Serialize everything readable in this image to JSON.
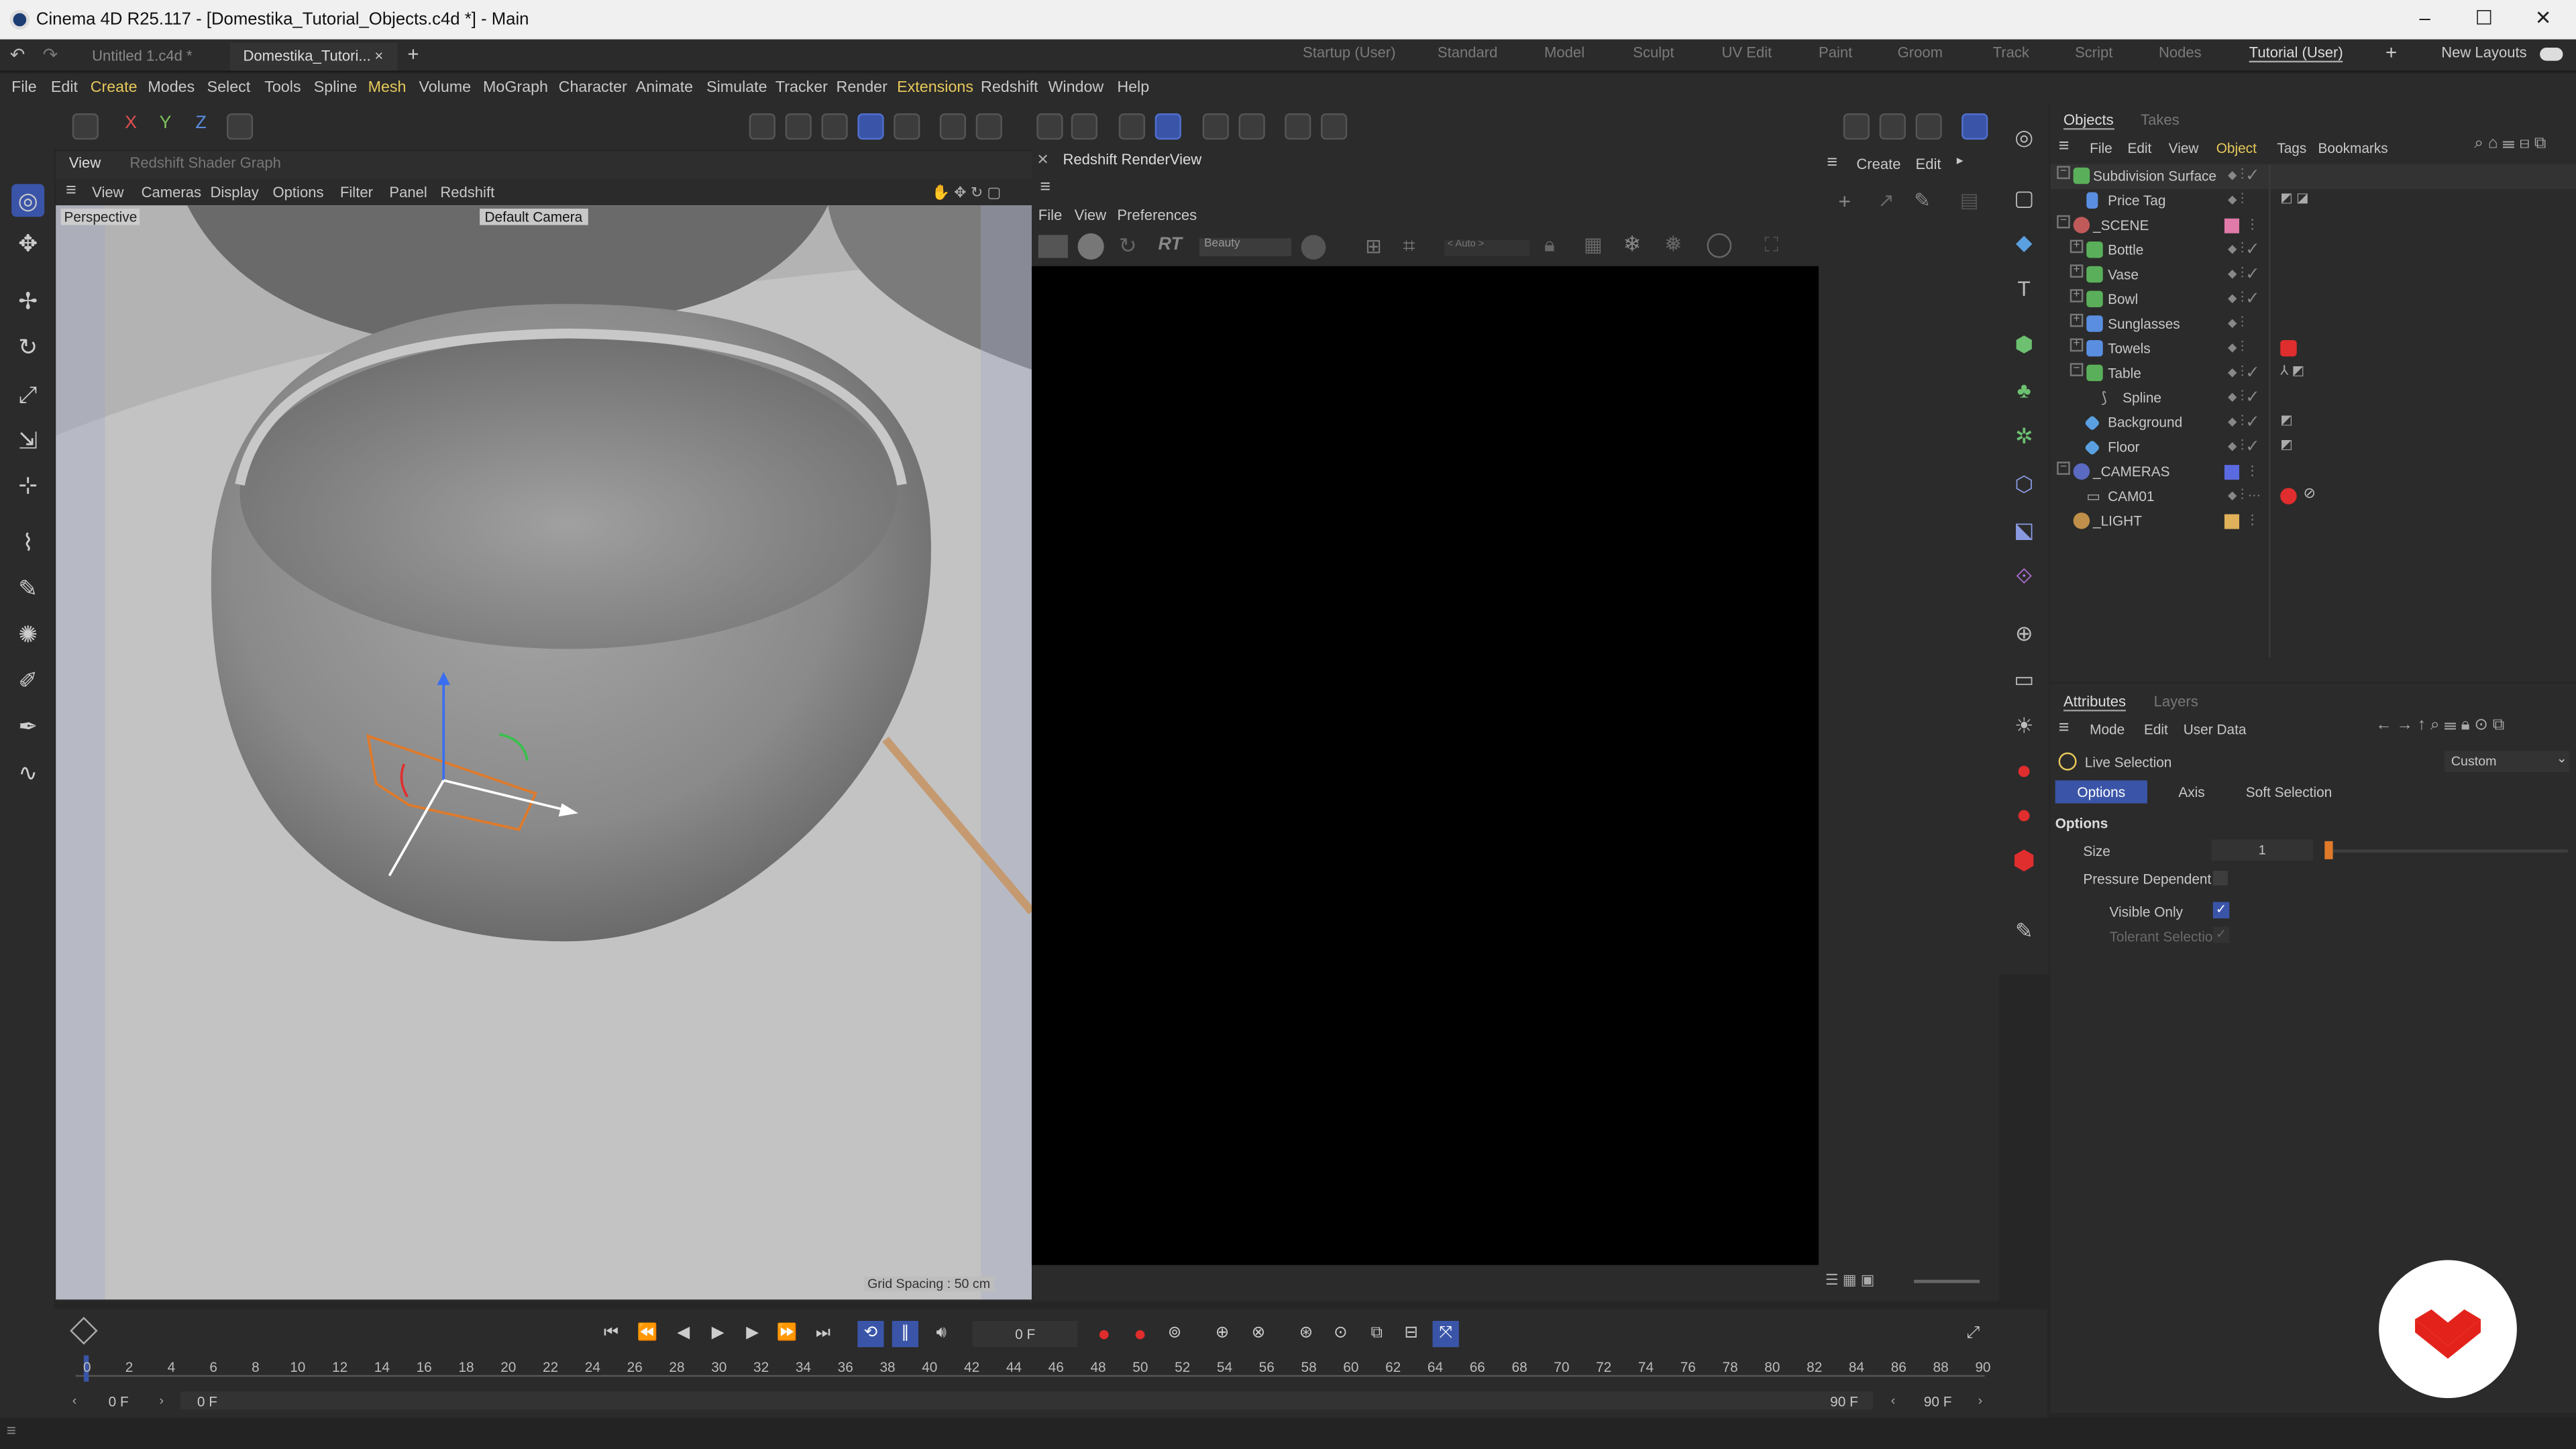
{
  "window": {
    "title": "Cinema 4D R25.117 - [Domestika_Tutorial_Objects.c4d *] - Main",
    "minimize": "–",
    "maximize": "☐",
    "close": "✕"
  },
  "doc_tabs": [
    "Untitled 1.c4d *",
    "Domestika_Tutori...",
    "×",
    "+"
  ],
  "layouts": [
    "Startup (User)",
    "Standard",
    "Model",
    "Sculpt",
    "UV Edit",
    "Paint",
    "Groom",
    "Track",
    "Script",
    "Nodes",
    "Tutorial (User)",
    "+",
    "New Layouts"
  ],
  "menu": [
    "File",
    "Edit",
    "Create",
    "Modes",
    "Select",
    "Tools",
    "Spline",
    "Mesh",
    "Volume",
    "MoGraph",
    "Character",
    "Animate",
    "Simulate",
    "Tracker",
    "Render",
    "Extensions",
    "Redshift",
    "Window",
    "Help"
  ],
  "axes": [
    "X",
    "Y",
    "Z"
  ],
  "viewport": {
    "tabs": [
      "View",
      "Redshift Shader Graph"
    ],
    "menu": [
      "View",
      "Cameras",
      "Display",
      "Options",
      "Filter",
      "Panel",
      "Redshift"
    ],
    "label": "Perspective",
    "camera": "Default Camera",
    "grid": "Grid Spacing : 50 cm"
  },
  "renderview": {
    "title": "Redshift RenderView",
    "menu": [
      "File",
      "View",
      "Preferences"
    ],
    "aov": "Beauty",
    "rt": "RT",
    "auto": "< Auto >"
  },
  "mid": {
    "create": "Create",
    "edit": "Edit"
  },
  "objects": {
    "tabs": [
      "Objects",
      "Takes"
    ],
    "menu": [
      "File",
      "Edit",
      "View",
      "Object",
      "Tags",
      "Bookmarks"
    ],
    "items": [
      {
        "name": "Subdivision Surface",
        "color": "#e7c95a"
      },
      {
        "name": "Price Tag",
        "color": "#e7a05a"
      },
      {
        "name": "_SCENE",
        "color": "#c8c8c8"
      },
      {
        "name": "Bottle",
        "color": "#c8c8c8"
      },
      {
        "name": "Vase",
        "color": "#c8c8c8"
      },
      {
        "name": "Bowl",
        "color": "#c8c8c8"
      },
      {
        "name": "Sunglasses",
        "color": "#c8c8c8"
      },
      {
        "name": "Towels",
        "color": "#c8c8c8"
      },
      {
        "name": "Table",
        "color": "#c8c8c8"
      },
      {
        "name": "Spline",
        "color": "#c8c8c8"
      },
      {
        "name": "Background",
        "color": "#c8c8c8"
      },
      {
        "name": "Floor",
        "color": "#c8c8c8"
      },
      {
        "name": "_CAMERAS",
        "color": "#c8c8c8"
      },
      {
        "name": "CAM01",
        "color": "#c8c8c8"
      },
      {
        "name": "_LIGHT",
        "color": "#c8c8c8"
      }
    ]
  },
  "attributes": {
    "tabs": [
      "Attributes",
      "Layers"
    ],
    "menu": [
      "Mode",
      "Edit",
      "User Data"
    ],
    "tool": "Live Selection",
    "preset": "Custom",
    "subtabs": [
      "Options",
      "Axis",
      "Soft Selection"
    ],
    "section": "Options",
    "size_label": "Size",
    "size_value": "1",
    "size_fraction": 0.0,
    "pressure": "Pressure Dependent",
    "visible_only": "Visible Only",
    "tolerant": "Tolerant Selection"
  },
  "timeline": {
    "frame": "0 F",
    "ticks": [
      "0",
      "2",
      "4",
      "6",
      "8",
      "10",
      "12",
      "14",
      "16",
      "18",
      "20",
      "22",
      "24",
      "26",
      "28",
      "30",
      "32",
      "34",
      "36",
      "38",
      "40",
      "42",
      "44",
      "46",
      "48",
      "50",
      "52",
      "54",
      "56",
      "58",
      "60",
      "62",
      "64",
      "66",
      "68",
      "70",
      "72",
      "74",
      "76",
      "78",
      "80",
      "82",
      "84",
      "86",
      "88",
      "90"
    ],
    "start": "0 F",
    "start2": "0 F",
    "end": "90 F",
    "end2": "90 F"
  },
  "colors": {
    "accent": "#3a55a8",
    "highlight": "#e7c95a",
    "record": "#e02d2d",
    "logo_red": "#e3231b"
  }
}
